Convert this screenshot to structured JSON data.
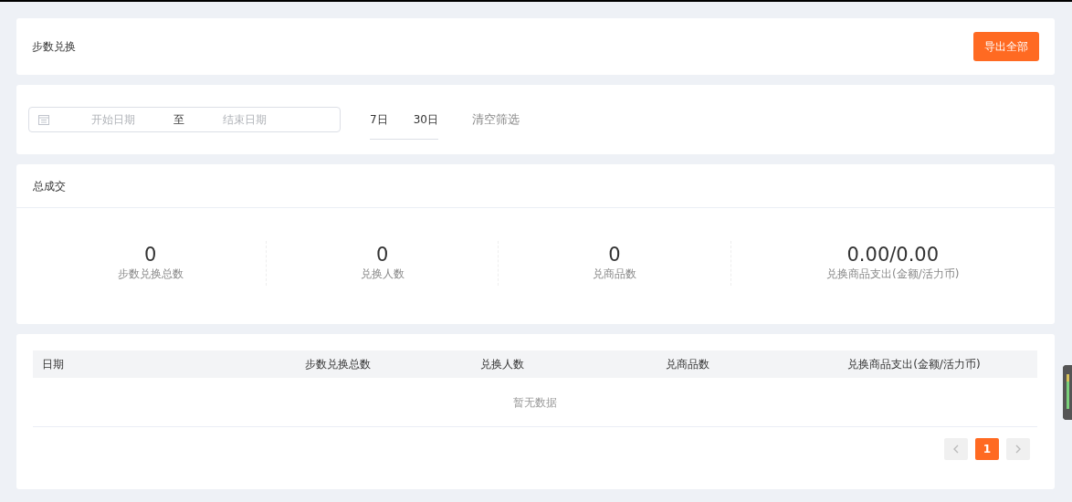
{
  "header": {
    "title": "步数兑换",
    "export_button": "导出全部"
  },
  "filter": {
    "start_placeholder": "开始日期",
    "separator": "至",
    "end_placeholder": "结束日期",
    "quick_ranges": [
      {
        "label": "7日",
        "selected": false
      },
      {
        "label": "30日",
        "selected": false
      }
    ],
    "clear": "清空筛选"
  },
  "summary": {
    "title": "总成交",
    "stats": [
      {
        "value": "0",
        "label": "步数兑换总数"
      },
      {
        "value": "0",
        "label": "兑换人数"
      },
      {
        "value": "0",
        "label": "兑商品数"
      },
      {
        "value": "0.00/0.00",
        "label": "兑换商品支出(金额/活力币)"
      }
    ]
  },
  "table": {
    "columns": [
      "日期",
      "步数兑换总数",
      "兑换人数",
      "兑商品数",
      "兑换商品支出(金额/活力币)"
    ],
    "empty_text": "暂无数据"
  },
  "pagination": {
    "prev_disabled": true,
    "next_disabled": true,
    "pages": [
      {
        "label": "1",
        "selected": true
      }
    ]
  }
}
